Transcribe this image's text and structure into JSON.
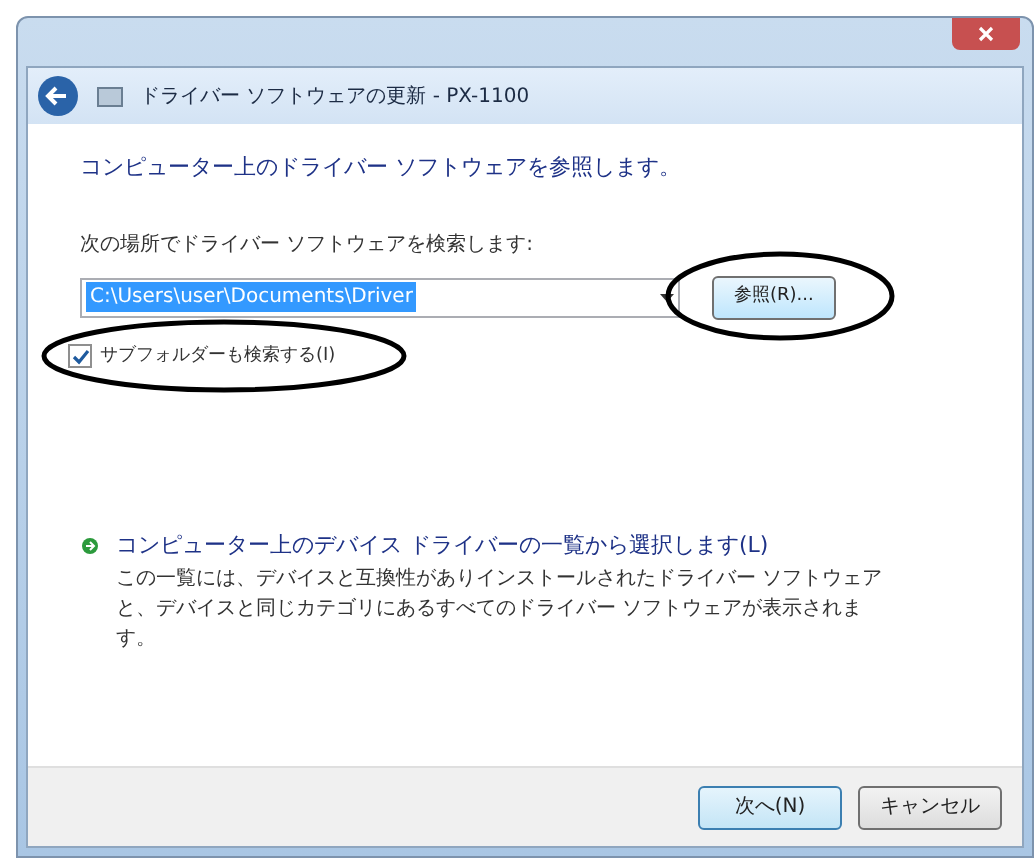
{
  "window": {
    "title": "ドライバー ソフトウェアの更新 - PX-1100"
  },
  "heading": "コンピューター上のドライバー ソフトウェアを参照します。",
  "search_label": "次の場所でドライバー ソフトウェアを検索します:",
  "path_field": {
    "value": "C:\\Users\\user\\Documents\\Driver"
  },
  "browse_button": "参照(R)...",
  "subfolder_checkbox": {
    "label": "サブフォルダーも検索する(I)",
    "checked": true
  },
  "option": {
    "title": "コンピューター上のデバイス ドライバーの一覧から選択します(L)",
    "description": "この一覧には、デバイスと互換性がありインストールされたドライバー ソフトウェアと、デバイスと同じカテゴリにあるすべてのドライバー ソフトウェアが表示されます。"
  },
  "buttons": [
    {
      "label": "次へ(N)",
      "default": true
    },
    {
      "label": "キャンセル",
      "default": false
    }
  ]
}
